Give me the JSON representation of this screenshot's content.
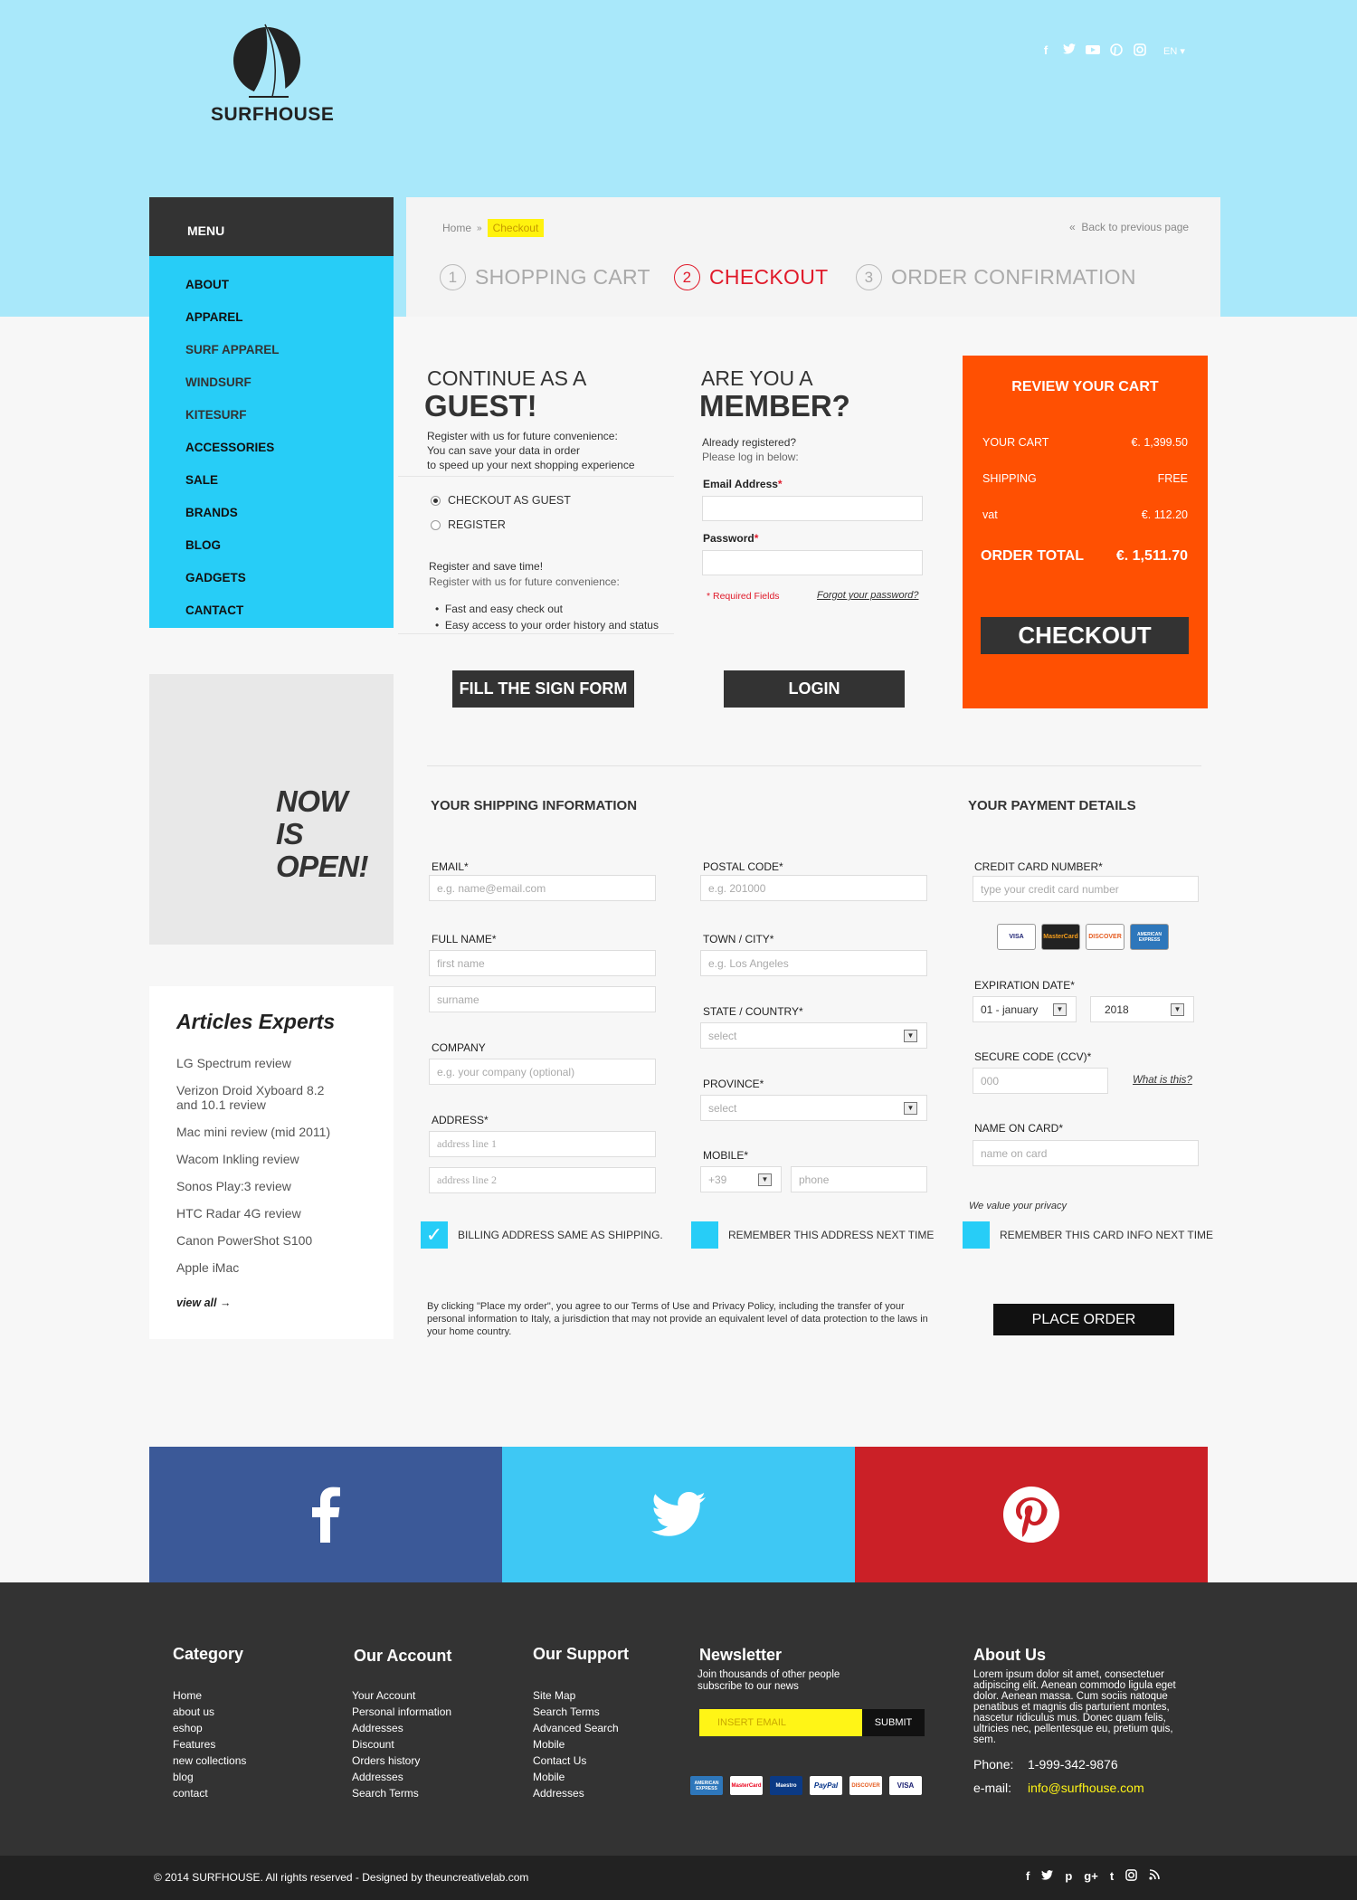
{
  "brand": {
    "name": "SURFHOUSE"
  },
  "header": {
    "social": [
      "f",
      "t",
      "yt",
      "p",
      "ig"
    ],
    "lang": "EN"
  },
  "menu": {
    "title": "MENU",
    "items": [
      "ABOUT",
      "APPAREL",
      "SURF APPAREL",
      "WINDSURF",
      "KITESURF",
      "ACCESSORIES",
      "SALE",
      "BRANDS",
      "BLOG",
      "GADGETS",
      "CANTACT"
    ]
  },
  "promo": {
    "line1": "NOW",
    "line2": "IS",
    "line3": "OPEN!"
  },
  "articles": {
    "title": "Articles Experts",
    "items": [
      "LG Spectrum review",
      "Verizon Droid Xyboard 8.2 and 10.1 review",
      "Mac mini review (mid 2011)",
      "Wacom Inkling review",
      "Sonos Play:3 review",
      "HTC Radar 4G review",
      "Canon PowerShot S100",
      "Apple iMac"
    ],
    "view_all": "view all →"
  },
  "breadcrumb": {
    "home": "Home",
    "sep": "»",
    "current": "Checkout"
  },
  "back_link": "Back to previous page",
  "steps": [
    {
      "num": "1",
      "label": "SHOPPING CART"
    },
    {
      "num": "2",
      "label": "CHECKOUT"
    },
    {
      "num": "3",
      "label": "ORDER CONFIRMATION"
    }
  ],
  "guest": {
    "title_small": "CONTINUE AS A",
    "title_big": "GUEST!",
    "desc1": "Register with us for future convenience:",
    "desc2": "You can save your data in order",
    "desc3": "to speed up your next shopping experience",
    "opt_guest": "CHECKOUT AS GUEST",
    "opt_register": "REGISTER",
    "save_title": "Register and save time!",
    "save_desc": "Register with us for future convenience:",
    "bullet1": "Fast and easy check out",
    "bullet2": "Easy access to your order history and status",
    "button": "FILL THE SIGN FORM"
  },
  "member": {
    "title_small": "ARE YOU A",
    "title_big": "MEMBER?",
    "desc1": "Already registered?",
    "desc2": "Please log in below:",
    "email_label": "Email Address",
    "password_label": "Password",
    "required_note": "* Required Fields",
    "forgot": "Forgot your password?",
    "button": "LOGIN"
  },
  "cart": {
    "title": "REVIEW YOUR CART",
    "your_cart_label": "YOUR CART",
    "your_cart_value": "€. 1,399.50",
    "shipping_label": "SHIPPING",
    "shipping_value": "FREE",
    "vat_label": "vat",
    "vat_value": "€. 112.20",
    "total_label": "ORDER TOTAL",
    "total_value": "€. 1,511.70",
    "button": "CHECKOUT"
  },
  "shipping": {
    "title": "YOUR SHIPPING INFORMATION",
    "email_label": "EMAIL*",
    "email_ph": "e.g. name@email.com",
    "fullname_label": "FULL NAME*",
    "first_ph": "first name",
    "sur_ph": "surname",
    "company_label": "COMPANY",
    "company_ph": "e.g. your company (optional)",
    "address_label": "ADDRESS*",
    "addr1_ph": "address line 1",
    "addr2_ph": "address line 2",
    "postal_label": "POSTAL CODE*",
    "postal_ph": "e.g. 201000",
    "town_label": "TOWN / CITY*",
    "town_ph": "e.g. Los Angeles",
    "state_label": "STATE / COUNTRY*",
    "state_value": "select",
    "province_label": "PROVINCE*",
    "province_value": "select",
    "mobile_label": "MOBILE*",
    "prefix_value": "+39",
    "phone_ph": "phone",
    "billing_same": "BILLING ADDRESS SAME AS SHIPPING.",
    "remember_address": "REMEMBER THIS ADDRESS NEXT TIME"
  },
  "payment": {
    "title": "YOUR PAYMENT DETAILS",
    "cc_label": "CREDIT CARD NUMBER*",
    "cc_ph": "type your credit card number",
    "cards": [
      "VISA",
      "MasterCard",
      "DISCOVER",
      "AMERICAN EXPRESS"
    ],
    "exp_label": "EXPIRATION DATE*",
    "month_value": "01 - january",
    "year_value": "2018",
    "ccv_label": "SECURE CODE (CCV)*",
    "ccv_ph": "000",
    "what_is_this": "What is this?",
    "name_label": "NAME ON CARD*",
    "name_ph": "name on card",
    "privacy": "We value your privacy",
    "remember_card": "REMEMBER THIS CARD INFO NEXT TIME"
  },
  "terms": "By clicking \"Place my order\", you agree to our Terms of Use and Privacy Policy, including the transfer of your personal information to Italy, a jurisdiction that may not provide an equivalent level of data protection to the laws in your home country.",
  "place_order": "PLACE ORDER",
  "social_band": {
    "facebook_color": "#3b5998",
    "twitter_color": "#3ec8f4",
    "pinterest_color": "#cb2027"
  },
  "footer": {
    "category": {
      "title": "Category",
      "links": [
        "Home",
        "about us",
        "eshop",
        "Features",
        "new collections",
        "blog",
        "contact"
      ]
    },
    "account": {
      "title": "Our Account",
      "links": [
        "Your Account",
        "Personal information",
        "Addresses",
        "Discount",
        "Orders history",
        "Addresses",
        "Search Terms"
      ]
    },
    "support": {
      "title": "Our Support",
      "links": [
        "Site Map",
        "Search Terms",
        "Advanced Search",
        "Mobile",
        "Contact Us",
        "Mobile",
        "Addresses"
      ]
    },
    "newsletter": {
      "title": "Newsletter",
      "desc": "Join thousands of other people subscribe to our news",
      "ph": "INSERT EMAIL",
      "button": "SUBMIT",
      "payments": [
        "AMERICAN EXPRESS",
        "MasterCard",
        "Maestro",
        "PayPal",
        "DISCOVER",
        "VISA"
      ]
    },
    "about": {
      "title": "About Us",
      "text": "Lorem ipsum dolor sit amet, consectetuer adipiscing elit. Aenean commodo ligula eget dolor. Aenean massa. Cum sociis natoque penatibus et magnis dis parturient montes, nascetur ridiculus mus. Donec quam felis, ultricies nec, pellentesque eu, pretium quis, sem.",
      "phone_label": "Phone:",
      "phone": "1-999-342-9876",
      "email_label": "e-mail:",
      "email": "info@surfhouse.com"
    },
    "copyright": "© 2014  SURFHOUSE. All rights reserved - Designed by theuncreativelab.com",
    "bottom_social": [
      "f",
      "t",
      "p",
      "g+",
      "t",
      "ig",
      "rss"
    ]
  }
}
